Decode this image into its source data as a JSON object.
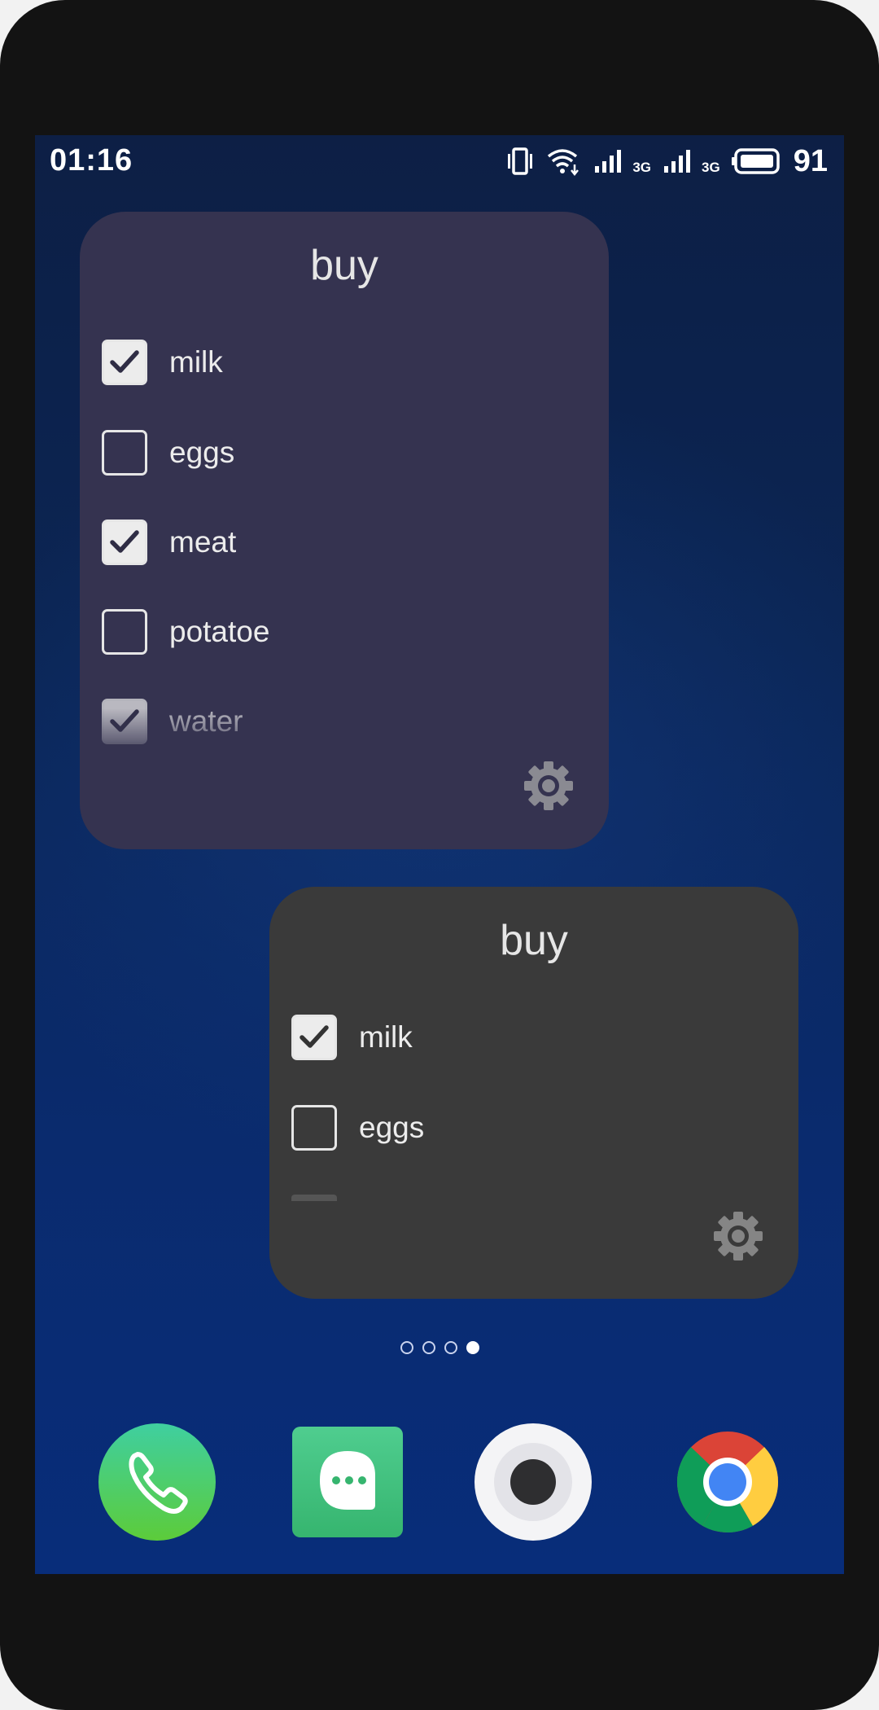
{
  "status_bar": {
    "time": "01:16",
    "net_type_1": "3G",
    "net_type_2": "3G",
    "battery": "91"
  },
  "widgets": [
    {
      "title": "buy",
      "theme": "#353350",
      "items": [
        {
          "label": "milk",
          "checked": true
        },
        {
          "label": "eggs",
          "checked": false
        },
        {
          "label": "meat",
          "checked": true
        },
        {
          "label": "potatoe",
          "checked": false
        },
        {
          "label": "water",
          "checked": true
        }
      ]
    },
    {
      "title": "buy",
      "theme": "#3a3a3a",
      "items": [
        {
          "label": "milk",
          "checked": true
        },
        {
          "label": "eggs",
          "checked": false
        }
      ]
    }
  ],
  "page_indicator": {
    "count": 4,
    "active": 4
  },
  "dock": [
    {
      "app": "phone",
      "icon": "phone-icon"
    },
    {
      "app": "messages",
      "icon": "message-icon"
    },
    {
      "app": "camera",
      "icon": "camera-icon"
    },
    {
      "app": "chrome",
      "icon": "chrome-icon"
    }
  ],
  "colors": {
    "accent_check": "#2f2d45",
    "wallpaper_top": "#0d1f45",
    "wallpaper_bottom": "#082d7a"
  }
}
